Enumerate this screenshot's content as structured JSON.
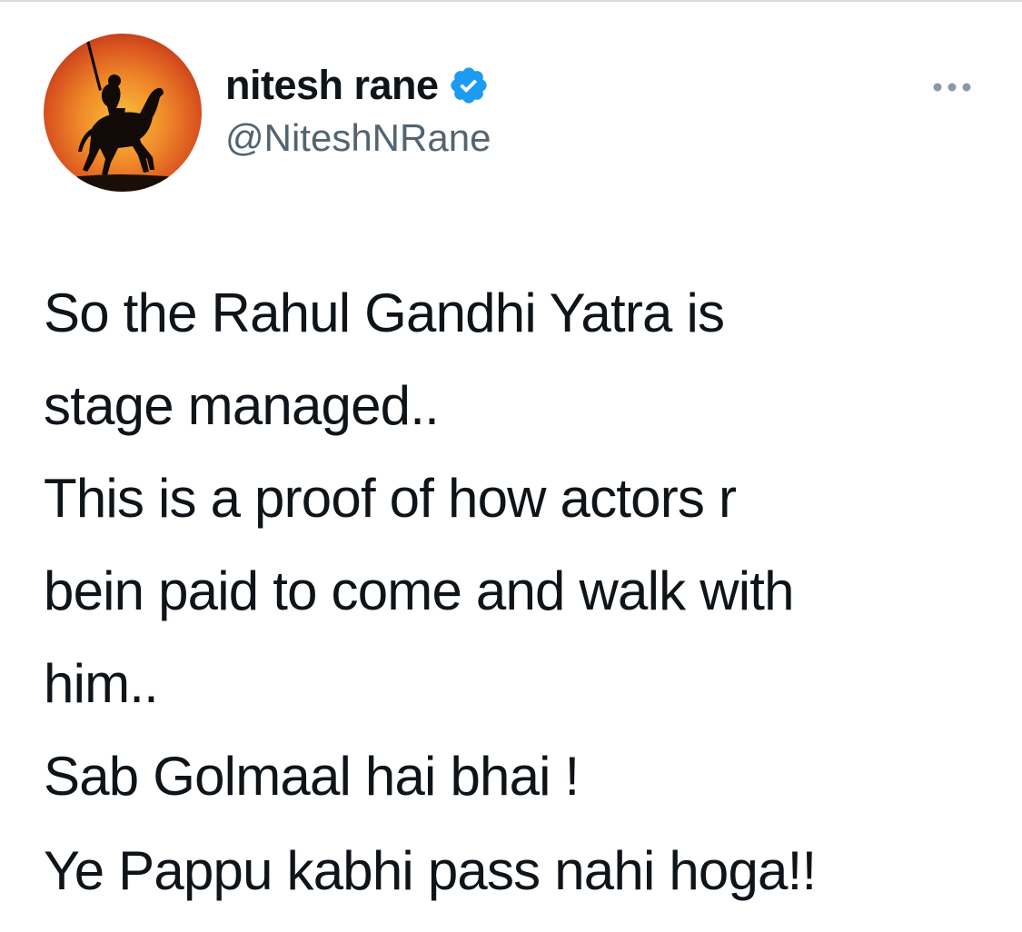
{
  "tweet": {
    "author": {
      "display_name": "nitesh rane",
      "handle": "@NiteshNRane",
      "verified": true,
      "verified_icon": "verified-badge-icon",
      "avatar_icon": "avatar-silhouette-horse-rider"
    },
    "more_icon": "more-options-icon",
    "text_lines": [
      "So the Rahul Gandhi Yatra is",
      "stage managed..",
      "This is a proof of how actors r",
      "bein paid to come and walk with",
      "him..",
      "Sab Golmaal hai bhai !",
      "Ye Pappu kabhi pass nahi hoga!!"
    ]
  },
  "colors": {
    "verified_blue": "#1d9bf0",
    "handle_gray": "#536471",
    "text": "#0f1419",
    "more_gray": "#8b98a5"
  }
}
